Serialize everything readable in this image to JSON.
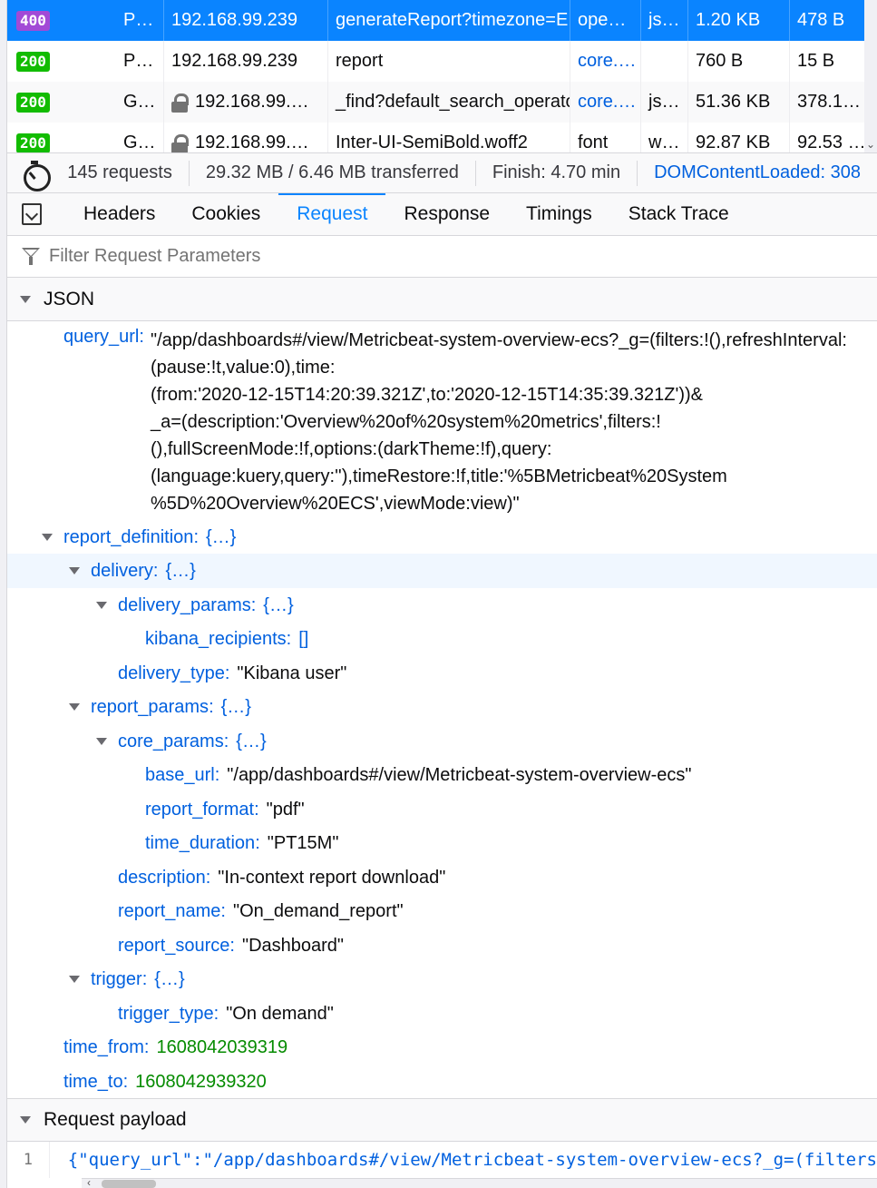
{
  "requests": [
    {
      "status": "400",
      "method": "P…",
      "domain": "192.168.99.239",
      "file": "generateReport?timezone=E",
      "initiator": "ope…",
      "type": "js…",
      "transferred": "1.20 KB",
      "size": "478 B",
      "selected": true,
      "secure": false
    },
    {
      "status": "200",
      "method": "P…",
      "domain": "192.168.99.239",
      "file": "report",
      "initiator": "core.…",
      "type": "",
      "transferred": "760 B",
      "size": "15 B",
      "selected": false,
      "secure": false
    },
    {
      "status": "200",
      "method": "G…",
      "domain": "192.168.99.…",
      "file": "_find?default_search_operato",
      "initiator": "core.…",
      "type": "js…",
      "transferred": "51.36 KB",
      "size": "378.1…",
      "selected": false,
      "secure": true
    },
    {
      "status": "200",
      "method": "G…",
      "domain": "192.168.99.…",
      "file": "Inter-UI-SemiBold.woff2",
      "initiator": "font",
      "type": "w…",
      "transferred": "92.87 KB",
      "size": "92.53 …",
      "selected": false,
      "secure": true
    }
  ],
  "statusbar": {
    "requests": "145 requests",
    "transferred": "29.32 MB / 6.46 MB transferred",
    "finish": "Finish: 4.70 min",
    "domcontent": "DOMContentLoaded: 308"
  },
  "tabs": [
    "Headers",
    "Cookies",
    "Request",
    "Response",
    "Timings",
    "Stack Trace"
  ],
  "active_tab": "Request",
  "filter": {
    "placeholder": "Filter Request Parameters"
  },
  "json_section": {
    "title": "JSON"
  },
  "query_url": {
    "key": "query_url",
    "lines": [
      "\"/app/dashboards#/view/Metricbeat-system-overview-ecs?_g=(filters:!(),refreshInterval:",
      "(pause:!t,value:0),time:",
      "(from:'2020-12-15T14:20:39.321Z',to:'2020-12-15T14:35:39.321Z'))&",
      "_a=(description:'Overview%20of%20system%20metrics',filters:!",
      "(),fullScreenMode:!f,options:(darkTheme:!f),query:",
      "(language:kuery,query:''),timeRestore:!f,title:'%5BMetricbeat%20System",
      "%5D%20Overview%20ECS',viewMode:view)\""
    ]
  },
  "tree": {
    "report_definition": "report_definition",
    "delivery": "delivery",
    "delivery_params": "delivery_params",
    "kibana_recipients": "kibana_recipients",
    "kibana_recipients_val": "[]",
    "delivery_type": "delivery_type",
    "delivery_type_val": "\"Kibana user\"",
    "report_params": "report_params",
    "core_params": "core_params",
    "base_url": "base_url",
    "base_url_val": "\"/app/dashboards#/view/Metricbeat-system-overview-ecs\"",
    "report_format": "report_format",
    "report_format_val": "\"pdf\"",
    "time_duration": "time_duration",
    "time_duration_val": "\"PT15M\"",
    "description": "description",
    "description_val": "\"In-context report download\"",
    "report_name": "report_name",
    "report_name_val": "\"On_demand_report\"",
    "report_source": "report_source",
    "report_source_val": "\"Dashboard\"",
    "trigger": "trigger",
    "trigger_type": "trigger_type",
    "trigger_type_val": "\"On demand\"",
    "time_from": "time_from",
    "time_from_val": "1608042039319",
    "time_to": "time_to",
    "time_to_val": "1608042939320",
    "collapsed": "{…}"
  },
  "payload": {
    "title": "Request payload",
    "line_number": "1",
    "code": "{\"query_url\":\"/app/dashboards#/view/Metricbeat-system-overview-ecs?_g=(filters"
  }
}
